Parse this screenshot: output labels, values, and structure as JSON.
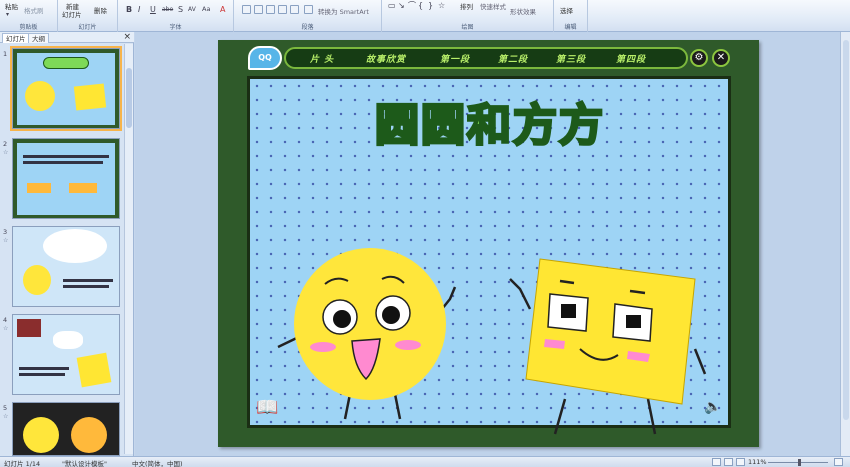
{
  "ribbon": {
    "clipboard": {
      "paste": "粘贴",
      "format_painter": "格式刷",
      "label": "剪贴板"
    },
    "slides": {
      "new_slide": "新建",
      "new_slide_2": "幻灯片",
      "delete": "删除",
      "label": "幻灯片"
    },
    "font": {
      "bold": "B",
      "italic": "I",
      "underline": "U",
      "strike": "abe",
      "shadow": "S",
      "spacing": "AV",
      "case": "Aa",
      "color": "A",
      "label": "字体"
    },
    "paragraph": {
      "smartart": "转换为 SmartArt",
      "label": "段落"
    },
    "drawing": {
      "arrange": "排列",
      "quick_styles": "快速样式",
      "shape_effects": "形状效果",
      "label": "绘图"
    },
    "editing": {
      "select": "选择",
      "label": "编辑"
    }
  },
  "left_panel": {
    "tab_slides": "幻灯片",
    "tab_outline": "大纲",
    "close": "×",
    "thumbs": [
      {
        "num": "1",
        "star": ""
      },
      {
        "num": "2",
        "star": "☆"
      },
      {
        "num": "3",
        "star": "☆"
      },
      {
        "num": "4",
        "star": "☆"
      },
      {
        "num": "5",
        "star": "☆"
      }
    ]
  },
  "slide": {
    "logo": "QQ",
    "nav": [
      "片 头",
      "故事欣赏",
      "第一段",
      "第二段",
      "第三段",
      "第四段"
    ],
    "title": "圆圆和方方",
    "btn_settings": "⚙",
    "btn_close": "✕",
    "book": "📖",
    "speaker": "🔈"
  },
  "status": {
    "slide_count": "幻灯片 1/14",
    "theme": "\"默认设计模板\"",
    "language": "中文(简体，中国)",
    "zoom": "111%"
  },
  "colors": {
    "circle": "#ffe63b",
    "square": "#ffe633",
    "blush": "#ff8ad0",
    "slide_bg": "#9ed4f5",
    "frame": "#2f5a2a"
  }
}
